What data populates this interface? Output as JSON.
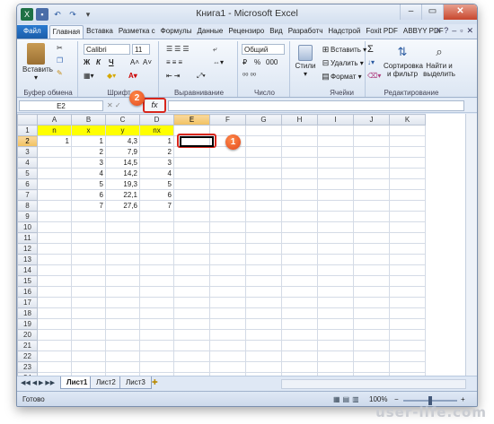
{
  "window": {
    "title": "Книга1 - Microsoft Excel"
  },
  "tabs": [
    "Файл",
    "Главная",
    "Вставка",
    "Разметка с",
    "Формулы",
    "Данные",
    "Рецензиро",
    "Вид",
    "Разработч",
    "Надстрой",
    "Foxit PDF",
    "ABBYY PDF"
  ],
  "active_tab": "Главная",
  "ribbon": {
    "clipboard": {
      "paste": "Вставить",
      "label": "Буфер обмена"
    },
    "font": {
      "name": "Calibri",
      "size": "11",
      "bold": "Ж",
      "italic": "К",
      "underline": "Ч",
      "grow": "A˄",
      "shrink": "A˅",
      "label": "Шрифт"
    },
    "alignment": {
      "label": "Выравнивание"
    },
    "number": {
      "format": "Общий",
      "currency": "₽",
      "percent": "%",
      "thousands": "000",
      "label": "Число"
    },
    "styles": {
      "btn": "Стили"
    },
    "cells": {
      "insert": "Вставить",
      "delete": "Удалить",
      "format": "Формат",
      "label": "Ячейки"
    },
    "editing": {
      "sum": "Σ",
      "sort": "Сортировка и фильтр",
      "find": "Найти и выделить",
      "label": "Редактирование"
    }
  },
  "formula_bar": {
    "cell_ref": "E2",
    "fx": "fx",
    "value": ""
  },
  "columns": [
    "A",
    "B",
    "C",
    "D",
    "E",
    "F",
    "G",
    "H",
    "I",
    "J",
    "K"
  ],
  "headers_row1": [
    "n",
    "x",
    "y",
    "nx"
  ],
  "rows": [
    [
      "1",
      "1",
      "4,3",
      "1"
    ],
    [
      "",
      "2",
      "7,9",
      "2"
    ],
    [
      "",
      "3",
      "14,5",
      "3"
    ],
    [
      "",
      "4",
      "14,2",
      "4"
    ],
    [
      "",
      "5",
      "19,3",
      "5"
    ],
    [
      "",
      "6",
      "22,1",
      "6"
    ],
    [
      "",
      "7",
      "27,6",
      "7"
    ]
  ],
  "row_count": 24,
  "selected_cell": "E2",
  "markers": {
    "one": "1",
    "two": "2"
  },
  "sheets": [
    "Лист1",
    "Лист2",
    "Лист3"
  ],
  "active_sheet": "Лист1",
  "status": {
    "ready": "Готово",
    "zoom": "100%",
    "minus": "−",
    "plus": "+"
  },
  "watermark": "user-life.com",
  "colors": {
    "highlight": "#ffff00",
    "marker": "#e2471c",
    "callout": "#d8261c"
  }
}
